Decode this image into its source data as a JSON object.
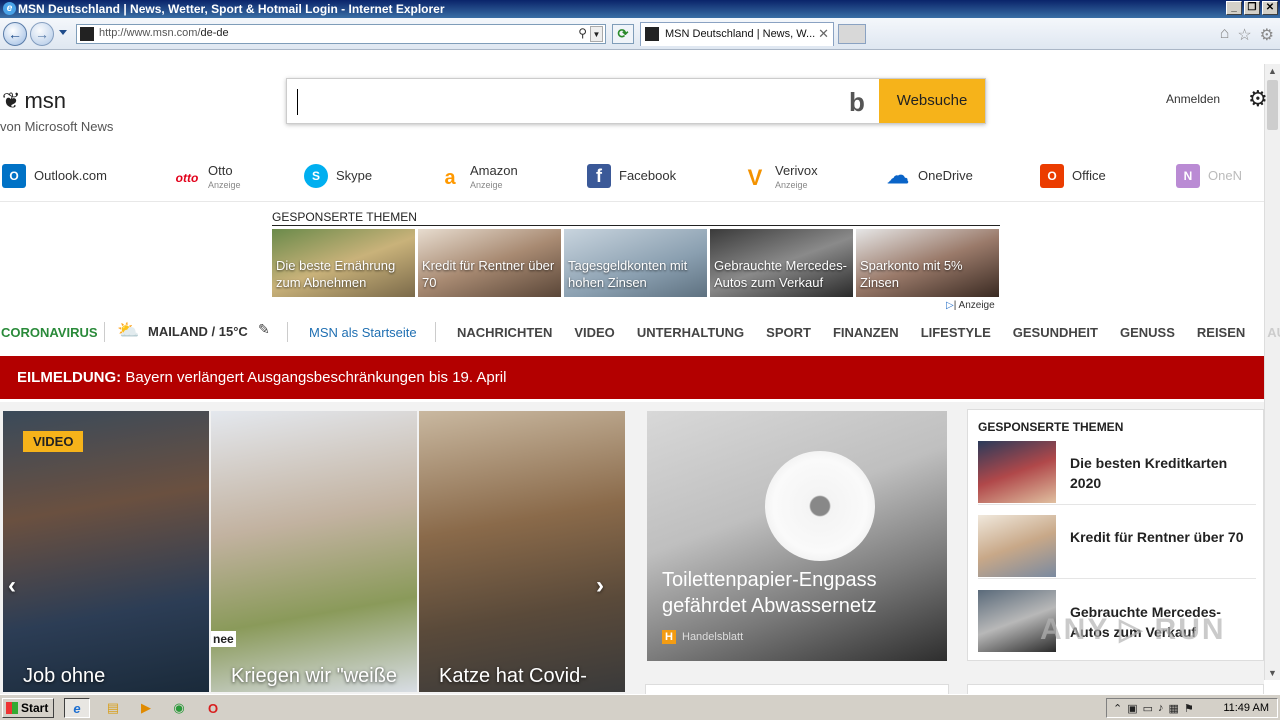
{
  "window": {
    "title": "MSN Deutschland | News, Wetter, Sport & Hotmail Login - Internet Explorer"
  },
  "browser": {
    "url_host": "http://www.msn.com/",
    "url_path": "de-de",
    "tab_title": "MSN Deutschland | News, W...",
    "address_favicon": "favicon",
    "tab_favicon": "favicon"
  },
  "header": {
    "logo": "msn",
    "subtitle": "von Microsoft News",
    "search_placeholder": "",
    "search_button": "Websuche",
    "signin": "Anmelden"
  },
  "quicklinks": [
    {
      "label": "Outlook.com",
      "ad": "",
      "icon": "outlook-icon",
      "icon_text": "O",
      "color": "#0072c6"
    },
    {
      "label": "Otto",
      "ad": "Anzeige",
      "icon": "otto-icon",
      "icon_text": "otto",
      "color": "#e2001a"
    },
    {
      "label": "Skype",
      "ad": "",
      "icon": "skype-icon",
      "icon_text": "S",
      "color": "#00aff0"
    },
    {
      "label": "Amazon",
      "ad": "Anzeige",
      "icon": "amazon-icon",
      "icon_text": "a",
      "color": "#ff9900"
    },
    {
      "label": "Facebook",
      "ad": "",
      "icon": "facebook-icon",
      "icon_text": "f",
      "color": "#3b5998"
    },
    {
      "label": "Verivox",
      "ad": "Anzeige",
      "icon": "verivox-icon",
      "icon_text": "V",
      "color": "#f39200"
    },
    {
      "label": "OneDrive",
      "ad": "",
      "icon": "onedrive-icon",
      "icon_text": "☁",
      "color": "#0a64c8"
    },
    {
      "label": "Office",
      "ad": "",
      "icon": "office-icon",
      "icon_text": "O",
      "color": "#eb3c00"
    },
    {
      "label": "OneN",
      "ad": "",
      "icon": "onenote-icon",
      "icon_text": "N",
      "color": "#7719aa"
    }
  ],
  "sponsored": {
    "heading": "GESPONSERTE THEMEN",
    "ad_label": "| Anzeige",
    "tiles": [
      "Die beste Ernährung zum Abnehmen",
      "Kredit für Rentner über 70",
      "Tagesgeldkonten mit hohen Zinsen",
      "Gebrauchte Mercedes-Autos zum Verkauf",
      "Sparkonto mit 5% Zinsen"
    ]
  },
  "nav": {
    "corona": "CORONAVIRUS",
    "weather": "MAILAND / 15°C",
    "startpage": "MSN als Startseite",
    "links": [
      "NACHRICHTEN",
      "VIDEO",
      "UNTERHALTUNG",
      "SPORT",
      "FINANZEN",
      "LIFESTYLE",
      "GESUNDHEIT",
      "GENUSS",
      "REISEN",
      "AU"
    ]
  },
  "breaking": {
    "label": "EILMELDUNG:",
    "text": " Bayern verlängert Ausgangsbeschränkungen bis 19. April"
  },
  "carousel": {
    "badge": "VIDEO",
    "slides": [
      "Job ohne",
      "Kriegen wir \"weiße",
      "Katze hat Covid-"
    ],
    "sign_text": "nee"
  },
  "feature": {
    "title": "Toilettenpapier-Engpass gefährdet Abwassernetz",
    "source_icon": "H",
    "source": "Handelsblatt"
  },
  "right_panel": {
    "heading": "GESPONSERTE THEMEN",
    "items": [
      "Die besten Kreditkarten 2020",
      "Kredit für Rentner über 70",
      "Gebrauchte Mercedes-Autos zum Verkauf"
    ]
  },
  "watermark": "ANY ▷ RUN",
  "taskbar": {
    "start": "Start",
    "clock": "11:49 AM"
  }
}
